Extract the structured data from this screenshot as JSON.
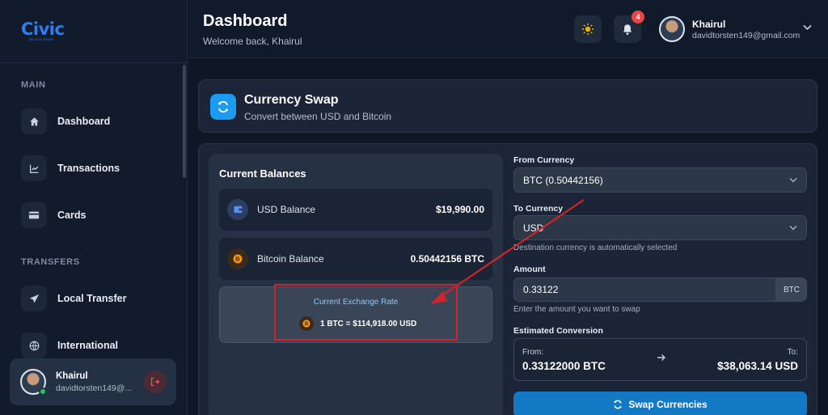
{
  "brand": {
    "logo_text": "Civic",
    "logo_sub": "BEACH BANK"
  },
  "sidebar": {
    "sections": {
      "main": "MAIN",
      "transfers": "TRANSFERS"
    },
    "items": [
      {
        "label": "Dashboard",
        "icon": "home-icon"
      },
      {
        "label": "Transactions",
        "icon": "chart-icon"
      },
      {
        "label": "Cards",
        "icon": "card-icon"
      },
      {
        "label": "Local Transfer",
        "icon": "send-icon"
      },
      {
        "label": "International",
        "icon": "globe-icon"
      }
    ],
    "user": {
      "name": "Khairul",
      "email": "davidtorsten149@..."
    }
  },
  "header": {
    "title": "Dashboard",
    "welcome": "Welcome back, Khairul",
    "notification_count": "4",
    "user": {
      "name": "Khairul",
      "email": "davidtorsten149@gmail.com"
    }
  },
  "page": {
    "title": "Currency Swap",
    "subtitle": "Convert between USD and Bitcoin"
  },
  "balances": {
    "title": "Current Balances",
    "usd": {
      "label": "USD Balance",
      "value": "$19,990.00"
    },
    "btc": {
      "label": "Bitcoin Balance",
      "value": "0.50442156 BTC"
    },
    "rate": {
      "label": "Current Exchange Rate",
      "value": "1 BTC = $114,918.00 USD"
    }
  },
  "form": {
    "from_label": "From Currency",
    "from_value": "BTC (0.50442156)",
    "to_label": "To Currency",
    "to_value": "USD",
    "to_hint": "Destination currency is automatically selected",
    "amount_label": "Amount",
    "amount_value": "0.33122",
    "amount_unit": "BTC",
    "amount_hint": "Enter the amount you want to swap",
    "estimate_label": "Estimated Conversion",
    "estimate": {
      "from_label": "From:",
      "from_value": "0.33122000 BTC",
      "to_label": "To:",
      "to_value": "$38,063.14 USD"
    },
    "submit_label": "Swap Currencies"
  },
  "colors": {
    "accent": "#1479c4",
    "annotation": "#d0232a",
    "bitcoin": "#f7931a"
  }
}
